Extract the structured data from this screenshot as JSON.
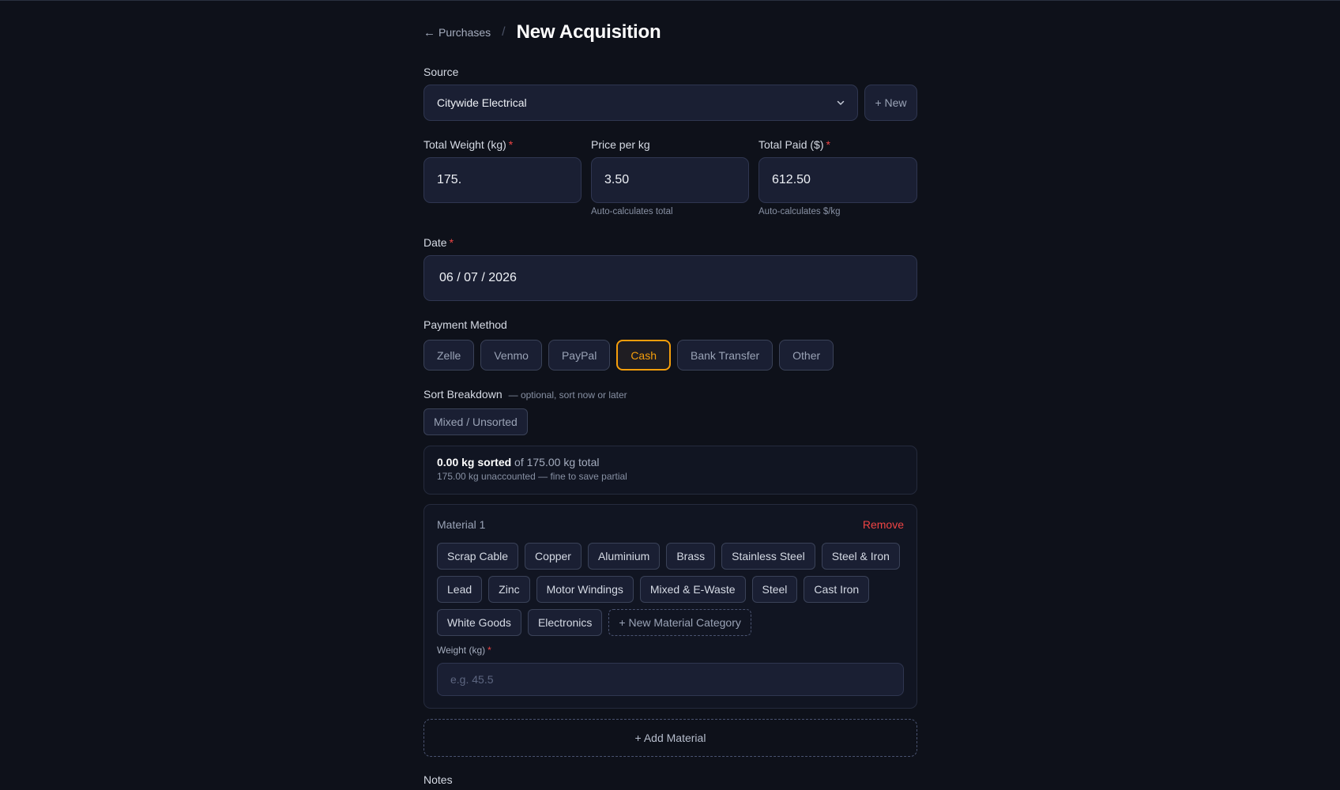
{
  "header": {
    "back_label": "Purchases",
    "separator": "/",
    "title": "New Acquisition"
  },
  "source": {
    "label": "Source",
    "selected": "Citywide Electrical",
    "new_label": "+ New"
  },
  "weight": {
    "label": "Total Weight (kg)",
    "value": "175."
  },
  "price": {
    "label": "Price per kg",
    "value": "3.50",
    "hint": "Auto-calculates total"
  },
  "total_paid": {
    "label": "Total Paid ($)",
    "value": "612.50",
    "hint": "Auto-calculates $/kg"
  },
  "date": {
    "label": "Date",
    "value": "06 / 07 / 2026"
  },
  "payment": {
    "label": "Payment Method",
    "methods": [
      "Zelle",
      "Venmo",
      "PayPal",
      "Cash",
      "Bank Transfer",
      "Other"
    ],
    "selected": "Cash"
  },
  "sort": {
    "label": "Sort Breakdown",
    "hint": "— optional, sort now or later",
    "mixed_label": "Mixed / Unsorted",
    "sorted_amount": "0.00 kg sorted",
    "sorted_total": "of 175.00 kg total",
    "unaccounted": "175.00 kg unaccounted — fine to save partial"
  },
  "material_1": {
    "title": "Material 1",
    "remove_label": "Remove",
    "categories": [
      "Scrap Cable",
      "Copper",
      "Aluminium",
      "Brass",
      "Stainless Steel",
      "Steel & Iron",
      "Lead",
      "Zinc",
      "Motor Windings",
      "Mixed & E-Waste",
      "Steel",
      "Cast Iron",
      "White Goods",
      "Electronics"
    ],
    "new_category_label": "+ New Material Category",
    "weight_label": "Weight (kg)",
    "weight_placeholder": "e.g. 45.5"
  },
  "add_material_label": "+ Add Material",
  "notes_label": "Notes",
  "required_mark": "*",
  "colors": {
    "accent": "#f59e0b",
    "required": "#ef4444",
    "background": "#0e111a"
  }
}
